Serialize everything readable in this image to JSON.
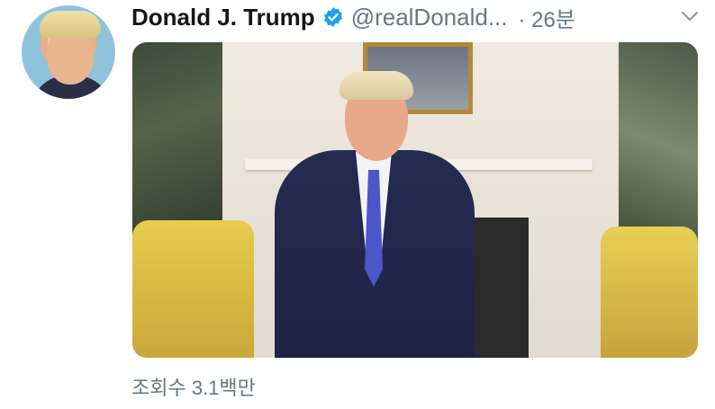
{
  "tweet": {
    "author_name": "Donald J. Trump",
    "handle": "@realDonald...",
    "time": "· 26분",
    "view_count": "조회수 3.1백만"
  },
  "icons": {
    "verified": "verified-badge-icon",
    "menu": "chevron-down-icon"
  },
  "colors": {
    "verified": "#1da1f2",
    "muted_text": "#657786",
    "primary_text": "#14171a"
  }
}
